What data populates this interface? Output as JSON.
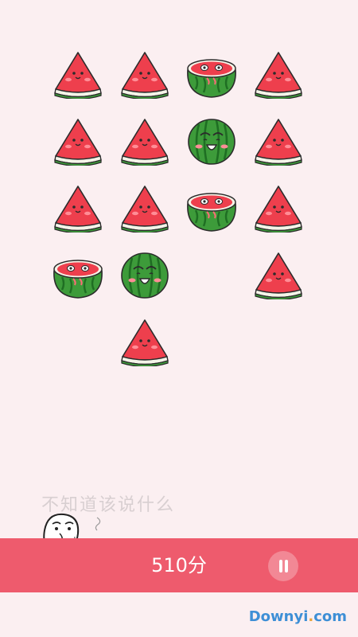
{
  "board": {
    "tiles": [
      {
        "kind": "slice"
      },
      {
        "kind": "slice"
      },
      {
        "kind": "half"
      },
      {
        "kind": "slice"
      },
      {
        "kind": "slice"
      },
      {
        "kind": "slice"
      },
      {
        "kind": "whole"
      },
      {
        "kind": "slice"
      },
      {
        "kind": "slice"
      },
      {
        "kind": "slice"
      },
      {
        "kind": "half"
      },
      {
        "kind": "slice"
      },
      {
        "kind": "half"
      },
      {
        "kind": "whole"
      },
      {
        "kind": "empty"
      },
      {
        "kind": "slice"
      },
      {
        "kind": "empty"
      },
      {
        "kind": "slice"
      },
      {
        "kind": "empty"
      },
      {
        "kind": "empty"
      }
    ],
    "columns": 4
  },
  "caption": "不知道该说什么",
  "score": "510分",
  "pause_icon": "pause-icon",
  "mascot_icon": "stick-figure-meme-icon",
  "watermark": {
    "main": "Downyi",
    "dot": ".",
    "tld": "com"
  },
  "colors": {
    "background": "#fbeff1",
    "bar": "#ee5b6d",
    "melon_red": "#ee3f4d",
    "rind_green": "#3d9b3a",
    "caption": "#d8cfd1"
  }
}
